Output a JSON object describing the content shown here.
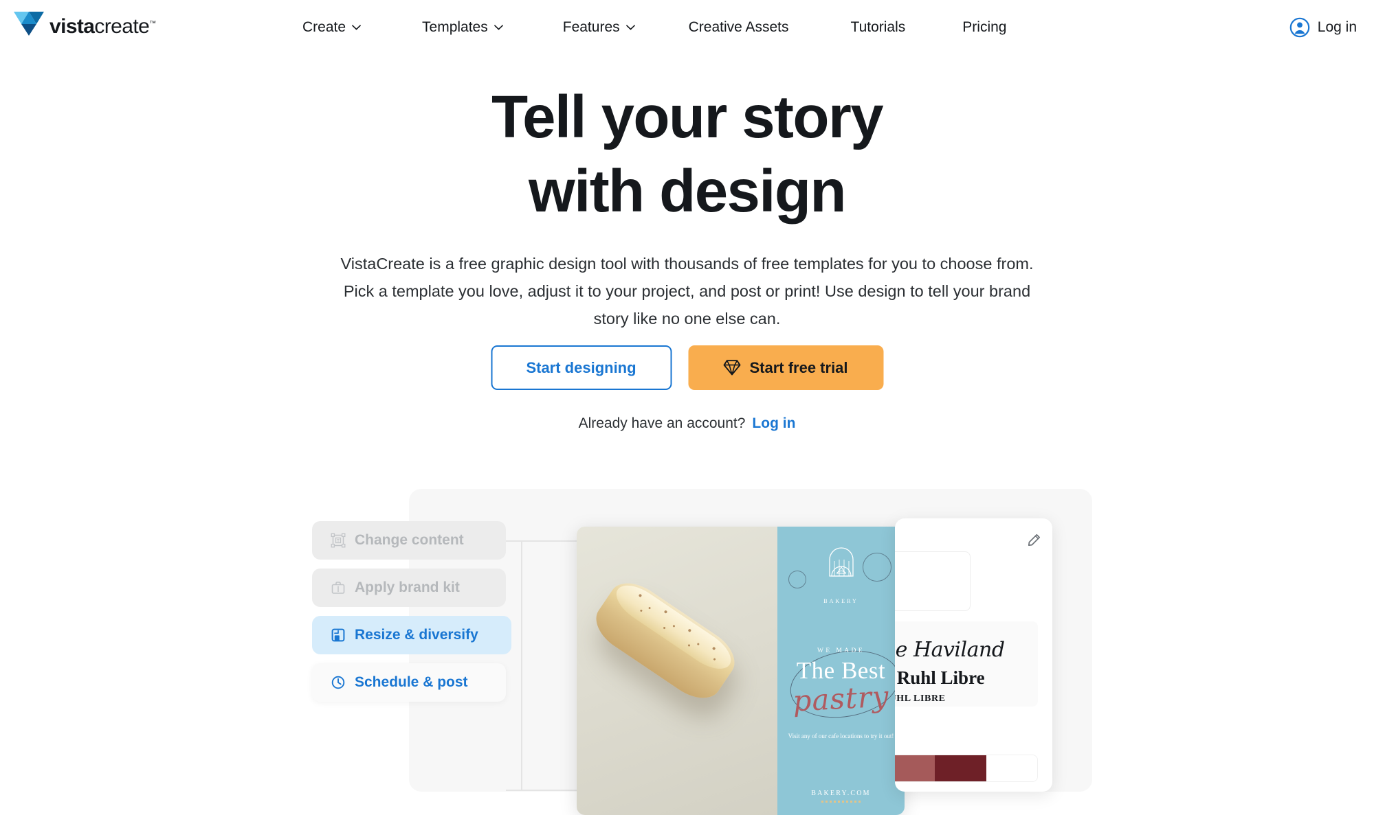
{
  "header": {
    "logo": {
      "word_bold": "vista",
      "word_light": "create",
      "tm": "™",
      "icon": "vistacreate-logo-icon"
    },
    "nav": [
      {
        "label": "Create",
        "has_dropdown": true
      },
      {
        "label": "Templates",
        "has_dropdown": true
      },
      {
        "label": "Features",
        "has_dropdown": true
      },
      {
        "label": "Creative Assets",
        "has_dropdown": false
      },
      {
        "label": "Tutorials",
        "has_dropdown": false
      },
      {
        "label": "Pricing",
        "has_dropdown": false
      }
    ],
    "login": {
      "label": "Log in",
      "icon": "user-avatar-icon",
      "color": "#1976d2"
    }
  },
  "hero": {
    "title_line1": "Tell your story",
    "title_line2": "with design",
    "subtitle": "VistaCreate is a free graphic design tool with thousands of free templates for you to choose from. Pick a template you love, adjust it to your project, and post or print! Use design to tell your brand story like no one else can.",
    "primary_cta": {
      "label": "Start designing",
      "style": "outline",
      "color": "#1976d2"
    },
    "secondary_cta": {
      "label": "Start free trial",
      "style": "solid",
      "icon": "diamond-icon",
      "color": "#f9ad4e"
    },
    "account_prompt": "Already have an account?",
    "account_link": "Log in"
  },
  "showcase": {
    "steps": [
      {
        "label": "Change content",
        "icon": "text-box-icon",
        "state": "muted"
      },
      {
        "label": "Apply brand kit",
        "icon": "briefcase-icon",
        "state": "muted"
      },
      {
        "label": "Resize & diversify",
        "icon": "resize-frame-icon",
        "state": "active"
      },
      {
        "label": "Schedule & post",
        "icon": "clock-icon",
        "state": "default"
      }
    ],
    "design_card": {
      "brand_mark_label": "BAKERY",
      "eyebrow": "WE MADE",
      "headline": "The Best",
      "script": "pastry",
      "body": "Visit any of our cafe locations to try it out!",
      "url": "BAKERY.COM",
      "accent_color": "#8ec6d6",
      "script_color": "#b05a5f"
    },
    "brand_kit": {
      "edit_icon": "pencil-icon",
      "fonts": [
        "Mr De Haviland",
        "Frank Ruhl Libre",
        "FRANK RUHL LIBRE"
      ],
      "colors": [
        "#d6b87e",
        "#a55a5a",
        "#6e2027",
        "#ffffff"
      ]
    }
  }
}
